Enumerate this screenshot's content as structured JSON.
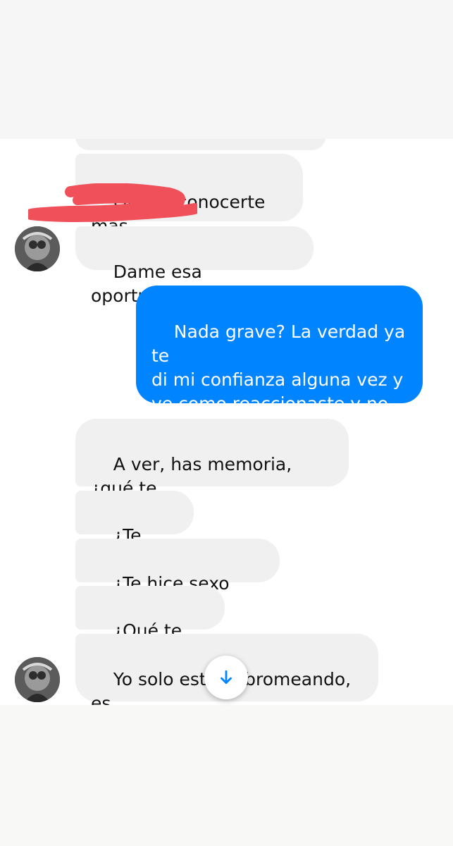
{
  "colors": {
    "incoming_bubble": "#f1f0f0",
    "outgoing_bubble": "#0184ff",
    "outgoing_text": "#ffffff",
    "incoming_text": "#111111"
  },
  "messages": [
    {
      "id": "m0",
      "sender": "contact",
      "text": ""
    },
    {
      "id": "m1",
      "sender": "contact",
      "text": "Quiero conocerte más"
    },
    {
      "id": "m2",
      "sender": "contact",
      "text": "Dame esa oportunidad."
    },
    {
      "id": "m3",
      "sender": "me",
      "text": "Nada grave? La verdad ya te\ndi mi confianza alguna vez y\nve como reaccionaste y no\npuedes ayudar pero gracias"
    },
    {
      "id": "m4",
      "sender": "contact",
      "text": "A ver, has memoria, ¿qué te\nhice?"
    },
    {
      "id": "m5",
      "sender": "contact",
      "text": "¿Te viole?"
    },
    {
      "id": "m6",
      "sender": "contact",
      "text": "¿Te hice sexo anal?"
    },
    {
      "id": "m7",
      "sender": "contact",
      "text": "¿Qué te hice?"
    },
    {
      "id": "m8",
      "sender": "contact",
      "text": "Yo solo estaba bromeando, es\ntodo",
      "emoji": "winking-face-emoji"
    }
  ],
  "icons": {
    "scroll_down": "arrow-down-icon",
    "avatar": "contact-avatar"
  }
}
